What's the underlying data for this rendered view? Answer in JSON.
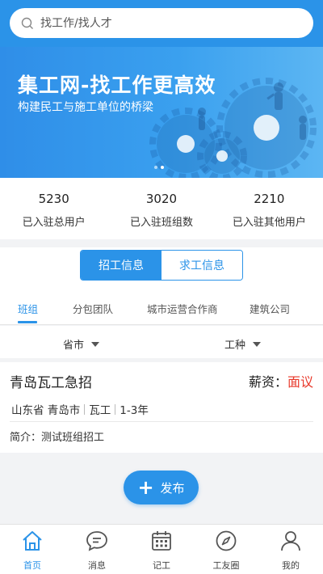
{
  "search": {
    "placeholder": "找工作/找人才"
  },
  "banner": {
    "title": "集工网-找工作更高效",
    "subtitle": "构建民工与施工单位的桥梁",
    "page_count": 2,
    "active_page": 1
  },
  "stats": [
    {
      "value": "5230",
      "label": "已入驻总用户"
    },
    {
      "value": "3020",
      "label": "已入驻班组数"
    },
    {
      "value": "2210",
      "label": "已入驻其他用户"
    }
  ],
  "segment": {
    "active": "招工信息",
    "inactive": "求工信息"
  },
  "tabs": [
    "班组",
    "分包团队",
    "城市运营合作商",
    "建筑公司"
  ],
  "filters": {
    "province": "省市",
    "trade": "工种"
  },
  "job": {
    "title": "青岛瓦工急招",
    "salary_label": "薪资：",
    "salary_value": "面议",
    "location": "山东省 青岛市",
    "trade": "瓦工",
    "experience": "1-3年",
    "intro": "简介：测试班组招工"
  },
  "publish": {
    "label": "发布"
  },
  "tabbar": [
    "首页",
    "消息",
    "记工",
    "工友圈",
    "我的"
  ],
  "colors": {
    "primary": "#2b93e8",
    "salary": "#e8382a"
  }
}
